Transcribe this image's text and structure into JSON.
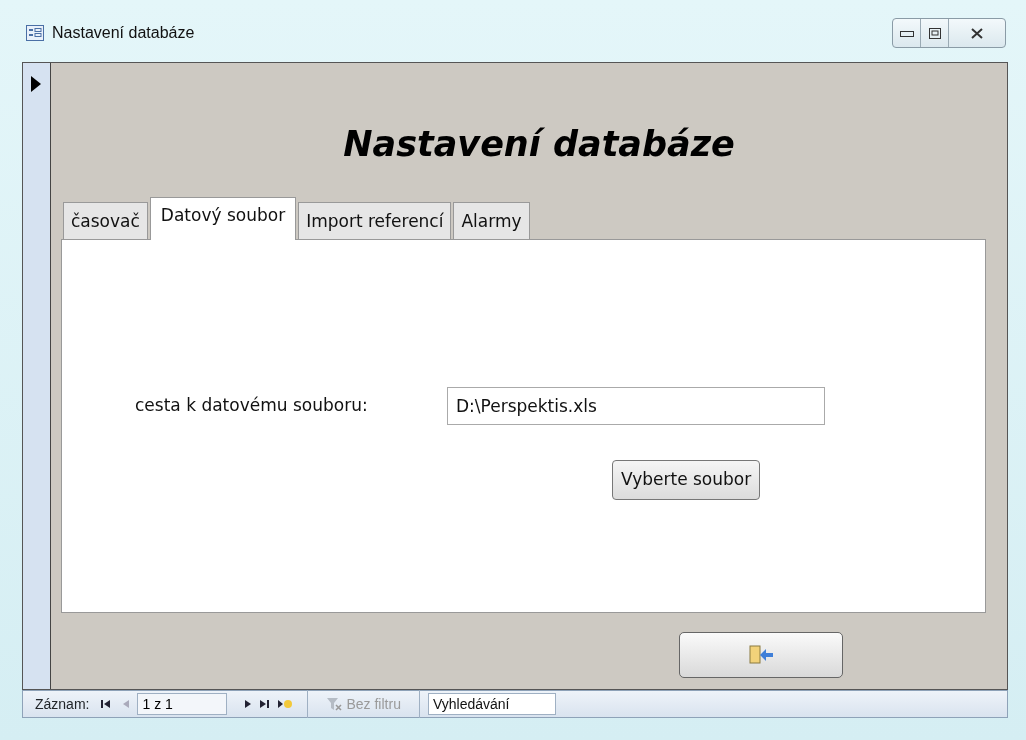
{
  "window": {
    "title": "Nastavení databáze"
  },
  "form": {
    "heading": "Nastavení databáze",
    "tabs": [
      {
        "label": "časovač",
        "selected": false
      },
      {
        "label": "Datový soubor",
        "selected": true
      },
      {
        "label": "Import referencí",
        "selected": false
      },
      {
        "label": "Alarmy",
        "selected": false
      }
    ],
    "field": {
      "label": "cesta k datovému souboru:",
      "value": "D:\\Perspektis.xls"
    },
    "browse_button": "Vyberte soubor"
  },
  "navigation": {
    "label": "Záznam:",
    "position": "1 z 1",
    "filter": {
      "label": "Bez filtru",
      "disabled": true
    },
    "search": {
      "placeholder": "Vyhledávání"
    }
  }
}
